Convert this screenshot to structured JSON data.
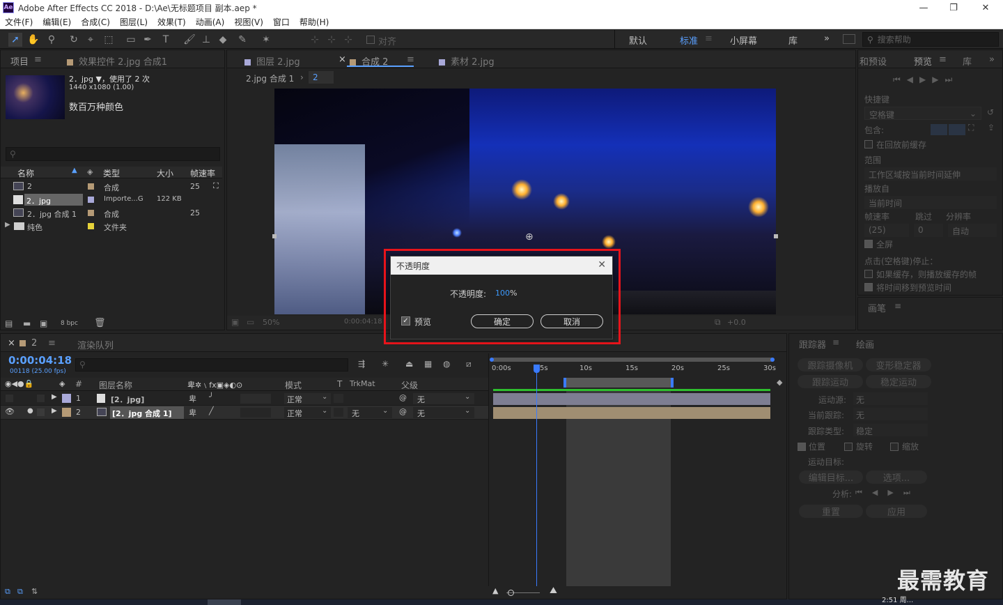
{
  "window": {
    "title": "Adobe After Effects CC 2018 - D:\\Ae\\无标题项目 副本.aep *",
    "logo": "Ae",
    "minimize": "—",
    "restore": "❐",
    "close": "✕"
  },
  "menu": [
    "文件(F)",
    "编辑(E)",
    "合成(C)",
    "图层(L)",
    "效果(T)",
    "动画(A)",
    "视图(V)",
    "窗口",
    "帮助(H)"
  ],
  "toolbar": {
    "align_label": "对齐",
    "workspaces": [
      "默认",
      "标准",
      "小屏幕",
      "库"
    ],
    "more": "»",
    "search_placeholder": "搜索帮助"
  },
  "project_panel": {
    "tab_project": "项目",
    "tab_effects": "效果控件 2.jpg 合成1",
    "item_name": "2．jpg ▼，使用了 2 次",
    "item_size": "1440 x1080 (1.00)",
    "item_color": "数百万种颜色",
    "columns": [
      "名称",
      "类型",
      "大小",
      "帧速率"
    ],
    "rows": [
      {
        "name": "2",
        "type": "合成",
        "size": "",
        "fps": "25",
        "color": "#b59a76"
      },
      {
        "name": "2．jpg",
        "type": "Importe...G",
        "size": "122 KB",
        "fps": "",
        "color": "#a8a8d8"
      },
      {
        "name": "2．jpg 合成 1",
        "type": "合成",
        "size": "",
        "fps": "25",
        "color": "#b59a76"
      },
      {
        "name": "纯色",
        "type": "文件夹",
        "size": "",
        "fps": "",
        "color": "#e6d23a"
      }
    ],
    "bpc": "8 bpc"
  },
  "comp_panel": {
    "tabs": [
      "图层 2.jpg",
      "合成 2",
      "素材 2.jpg"
    ],
    "breadcrumb_1": "2.jpg 合成 1",
    "breadcrumb_2": "2",
    "zoom": "50%",
    "timecode": "0:00:04:18",
    "exposure": "+0.0"
  },
  "preview_panel": {
    "tab_info": "和预设",
    "tab_preview": "预览",
    "tab_lib": "库",
    "shortcut_label": "快捷键",
    "shortcut_value": "空格键",
    "include_label": "包含:",
    "cache_label": "在回放前缓存",
    "range_label": "范围",
    "range_value": "工作区域按当前时间延伸",
    "play_from_label": "播放自",
    "play_from_value": "当前时间",
    "fps_label": "帧速率",
    "skip_label": "跳过",
    "res_label": "分辨率",
    "fps_value": "(25)",
    "skip_value": "0",
    "res_value": "自动",
    "fullscreen_label": "全屏",
    "stop_label": "点击(空格键)停止：",
    "opt1": "如果缓存，则播放缓存的帧",
    "opt2": "将时间移到预览时间",
    "brush_tab": "画笔"
  },
  "dialog": {
    "title": "不透明度",
    "label": "不透明度:",
    "value": "100",
    "unit": "%",
    "preview_label": "预览",
    "ok": "确定",
    "cancel": "取消"
  },
  "timeline": {
    "tab_comp": "2",
    "tab_render": "渲染队列",
    "timecode": "0:00:04:18",
    "frame_info": "00118 (25.00 fps)",
    "columns": {
      "num": "#",
      "layer_name": "图层名称",
      "mode": "模式",
      "t": "T",
      "trkmat": "TrkMat",
      "parent": "父级"
    },
    "ruler": [
      "0:00s",
      "5s",
      "10s",
      "15s",
      "20s",
      "25s",
      "30s"
    ],
    "layers": [
      {
        "num": "1",
        "name": "[2．jpg]",
        "mode": "正常",
        "trkmat": "",
        "parent": "无",
        "color": "#a8a8d8"
      },
      {
        "num": "2",
        "name": "[2．jpg 合成 1]",
        "mode": "正常",
        "trkmat": "无",
        "parent": "无",
        "color": "#b59a76"
      }
    ]
  },
  "tracker_panel": {
    "tab_tracker": "跟踪器",
    "tab_paint": "绘画",
    "track_camera": "跟踪摄像机",
    "warp_stabilizer": "变形稳定器",
    "track_motion": "跟踪运动",
    "stabilize_motion": "稳定运动",
    "motion_source_label": "运动源:",
    "motion_source_value": "无",
    "current_track_label": "当前跟踪:",
    "current_track_value": "无",
    "track_type_label": "跟踪类型:",
    "track_type_value": "稳定",
    "position": "位置",
    "rotation": "旋转",
    "scale": "缩放",
    "motion_target": "运动目标:",
    "edit_target": "编辑目标...",
    "options": "选项...",
    "analyze": "分析:",
    "reset": "重置",
    "apply": "应用"
  },
  "watermark": "最需教育",
  "clock": "2:51 周..."
}
